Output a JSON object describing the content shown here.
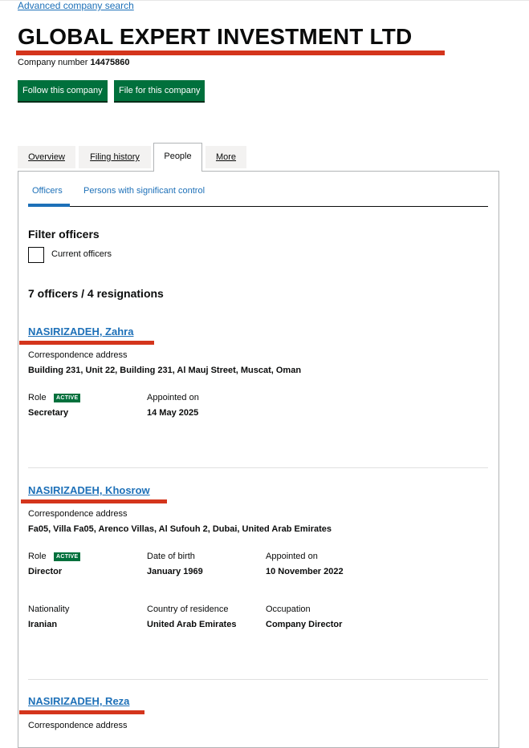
{
  "header": {
    "advanced_search": "Advanced company search",
    "company_name": "GLOBAL EXPERT INVESTMENT LTD",
    "company_number_label": "Company number",
    "company_number": "14475860"
  },
  "actions": {
    "follow": "Follow this company",
    "file": "File for this company"
  },
  "tabs": [
    {
      "label": "Overview",
      "active": false
    },
    {
      "label": "Filing history",
      "active": false
    },
    {
      "label": "People",
      "active": true
    },
    {
      "label": "More",
      "active": false
    }
  ],
  "subtabs": [
    {
      "label": "Officers",
      "active": true
    },
    {
      "label": "Persons with significant control",
      "active": false
    }
  ],
  "filter": {
    "heading": "Filter officers",
    "checkbox_label": "Current officers",
    "checked": false
  },
  "summary": "7 officers / 4 resignations",
  "labels": {
    "address": "Correspondence address",
    "role": "Role",
    "appointed": "Appointed on",
    "dob": "Date of birth",
    "nationality": "Nationality",
    "residence": "Country of residence",
    "occupation": "Occupation"
  },
  "officers": [
    {
      "name": "NASIRIZADEH, Zahra",
      "address": "Building 231, Unit 22, Building 231, Al Mauj Street, Muscat, Oman",
      "status": "ACTIVE",
      "role": "Secretary",
      "appointed": "14 May 2025"
    },
    {
      "name": "NASIRIZADEH, Khosrow",
      "address": "Fa05, Villa Fa05, Arenco Villas, Al Sufouh 2, Dubai, United Arab Emirates",
      "status": "ACTIVE",
      "role": "Director",
      "dob": "January 1969",
      "appointed": "10 November 2022",
      "nationality": "Iranian",
      "residence": "United Arab Emirates",
      "occupation": "Company Director"
    },
    {
      "name": "NASIRIZADEH, Reza"
    }
  ],
  "colors": {
    "link": "#1d70b8",
    "button": "#00703c",
    "highlight": "#d4351c"
  }
}
